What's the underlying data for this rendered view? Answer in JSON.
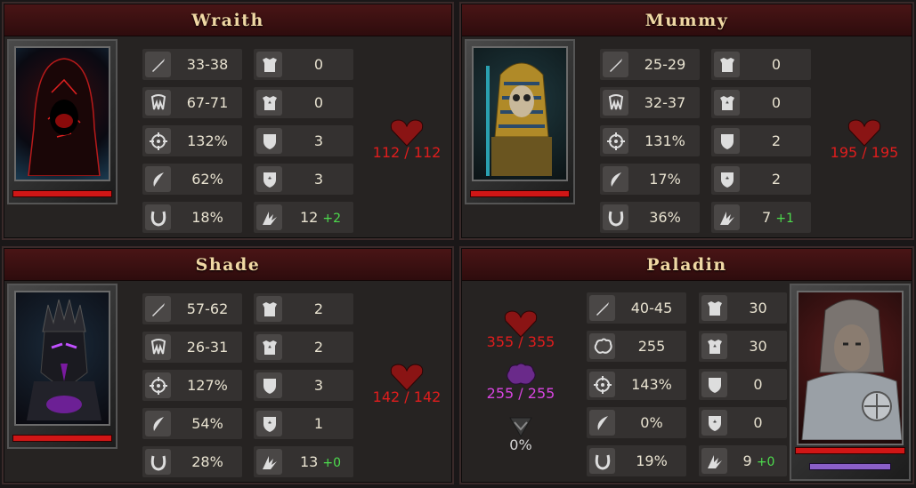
{
  "panels": [
    {
      "name": "Wraith",
      "health": "112 / 112",
      "left": [
        {
          "icon": "sword-icon",
          "value": "33-38"
        },
        {
          "icon": "crit-fang-icon",
          "value": "67-71"
        },
        {
          "icon": "target-icon",
          "value": "132%"
        },
        {
          "icon": "crescent-icon",
          "value": "62%"
        },
        {
          "icon": "horseshoe-icon",
          "value": "18%"
        }
      ],
      "right": [
        {
          "icon": "armor-icon",
          "value": "0"
        },
        {
          "icon": "magic-armor-icon",
          "value": "0"
        },
        {
          "icon": "shield-icon",
          "value": "3"
        },
        {
          "icon": "magic-shield-icon",
          "value": "3"
        },
        {
          "icon": "speed-icon",
          "value": "12",
          "bonus": "+2"
        }
      ]
    },
    {
      "name": "Mummy",
      "health": "195 / 195",
      "left": [
        {
          "icon": "sword-icon",
          "value": "25-29"
        },
        {
          "icon": "crit-fang-icon",
          "value": "32-37"
        },
        {
          "icon": "target-icon",
          "value": "131%"
        },
        {
          "icon": "crescent-icon",
          "value": "17%"
        },
        {
          "icon": "horseshoe-icon",
          "value": "36%"
        }
      ],
      "right": [
        {
          "icon": "armor-icon",
          "value": "0"
        },
        {
          "icon": "magic-armor-icon",
          "value": "0"
        },
        {
          "icon": "shield-icon",
          "value": "2"
        },
        {
          "icon": "magic-shield-icon",
          "value": "2"
        },
        {
          "icon": "speed-icon",
          "value": "7",
          "bonus": "+1"
        }
      ]
    },
    {
      "name": "Shade",
      "health": "142 / 142",
      "left": [
        {
          "icon": "sword-icon",
          "value": "57-62"
        },
        {
          "icon": "crit-fang-icon",
          "value": "26-31"
        },
        {
          "icon": "target-icon",
          "value": "127%"
        },
        {
          "icon": "crescent-icon",
          "value": "54%"
        },
        {
          "icon": "horseshoe-icon",
          "value": "28%"
        }
      ],
      "right": [
        {
          "icon": "armor-icon",
          "value": "2"
        },
        {
          "icon": "magic-armor-icon",
          "value": "2"
        },
        {
          "icon": "shield-icon",
          "value": "3"
        },
        {
          "icon": "magic-shield-icon",
          "value": "1"
        },
        {
          "icon": "speed-icon",
          "value": "13",
          "bonus": "+0"
        }
      ]
    },
    {
      "name": "Paladin",
      "health": "355 / 355",
      "mana": "255 / 255",
      "dodge": "0%",
      "left": [
        {
          "icon": "sword-icon",
          "value": "40-45"
        },
        {
          "icon": "brain-icon",
          "value": "255"
        },
        {
          "icon": "target-icon",
          "value": "143%"
        },
        {
          "icon": "crescent-icon",
          "value": "0%"
        },
        {
          "icon": "horseshoe-icon",
          "value": "19%"
        }
      ],
      "right": [
        {
          "icon": "armor-icon",
          "value": "30"
        },
        {
          "icon": "magic-armor-icon",
          "value": "30"
        },
        {
          "icon": "shield-icon",
          "value": "0"
        },
        {
          "icon": "magic-shield-icon",
          "value": "0"
        },
        {
          "icon": "speed-icon",
          "value": "9",
          "bonus": "+0"
        }
      ]
    }
  ]
}
